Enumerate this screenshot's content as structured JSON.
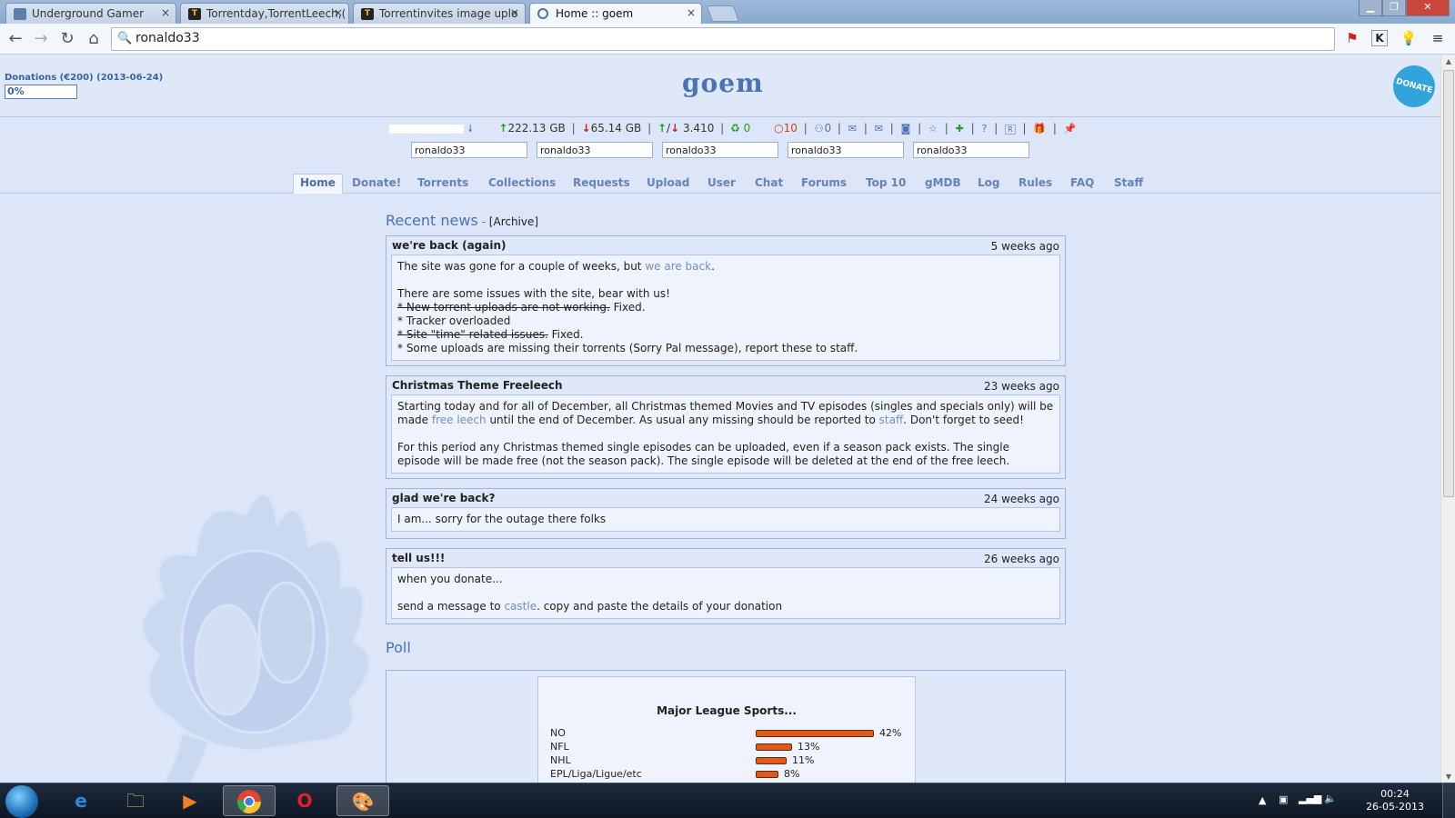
{
  "browser": {
    "tabs": [
      {
        "title": "Underground Gamer",
        "icon_color": "#5a7fa8"
      },
      {
        "title": "Torrentday,TorrentLeech,(",
        "icon_color": "#222222"
      },
      {
        "title": "Torrentinvites image uplo",
        "icon_color": "#222222"
      },
      {
        "title": "Home :: goem",
        "icon_color": "#4a72b4"
      }
    ],
    "close_glyph": "×",
    "address": "ronaldo33"
  },
  "header": {
    "donations": "Donations (€200) (2013-06-24)",
    "donation_progress": "0%",
    "logo": "goem",
    "donate_badge": "DONATE"
  },
  "stats": {
    "uploaded": "222.13 GB",
    "downloaded": "65.14 GB",
    "ratio": "3.410",
    "seeding": "0",
    "bonus": "10",
    "messages": "0",
    "r_label": "R"
  },
  "search_boxes": [
    "ronaldo33",
    "ronaldo33",
    "ronaldo33",
    "ronaldo33",
    "ronaldo33"
  ],
  "nav": [
    "Home",
    "Donate!",
    "Torrents",
    "Collections",
    "Requests",
    "Upload",
    "User",
    "Chat",
    "Forums",
    "Top 10",
    "gMDB",
    "Log",
    "Rules",
    "FAQ",
    "Staff"
  ],
  "news": {
    "title": "Recent news",
    "dash": "-",
    "archive": "[Archive]",
    "items": [
      {
        "title": "we're back (again)",
        "when": "5 weeks ago",
        "l1a": "The site was gone for a couple of weeks, but ",
        "l1link": "we are back",
        "l1b": ".",
        "l2": "There are some issues with the site, bear with us!",
        "l3s": "* New torrent uploads are not working.",
        "l3": " Fixed.",
        "l4": "* Tracker overloaded",
        "l5s": "* Site \"time\" related issues.",
        "l5": " Fixed.",
        "l6": "* Some uploads are missing their torrents (Sorry Pal message), report these to staff."
      },
      {
        "title": "Christmas Theme Freeleech",
        "when": "23 weeks ago",
        "p1a": "Starting today and for all of December, all Christmas themed Movies and TV episodes (singles and specials only) will be made ",
        "p1link1": "free leech",
        "p1b": " until the end of December. As usual any missing should be reported to ",
        "p1link2": "staff",
        "p1c": ". Don't forget to seed!",
        "p2": "For this period any Christmas themed single episodes can be uploaded, even if a season pack exists. The single episode will be made free (not the season pack). The single episode will be deleted at the end of the free leech."
      },
      {
        "title": "glad we're back?",
        "when": "24 weeks ago",
        "body": "I am...  sorry for the outage there folks"
      },
      {
        "title": "tell us!!!",
        "when": "26 weeks ago",
        "l1": "when you donate...",
        "l2a": "send a message to ",
        "l2link": "castle",
        "l2b": ".  copy and paste the details of your donation"
      }
    ]
  },
  "poll": {
    "title": "Poll",
    "question": "Major League Sports...",
    "options": [
      {
        "label": "NO",
        "pct_label": "42%",
        "pct": 42
      },
      {
        "label": "NFL",
        "pct_label": "13%",
        "pct": 13
      },
      {
        "label": "NHL",
        "pct_label": "11%",
        "pct": 11
      },
      {
        "label": "EPL/Liga/Ligue/etc",
        "pct_label": "8%",
        "pct": 8
      }
    ]
  },
  "taskbar": {
    "time": "00:24",
    "date": "26-05-2013"
  }
}
